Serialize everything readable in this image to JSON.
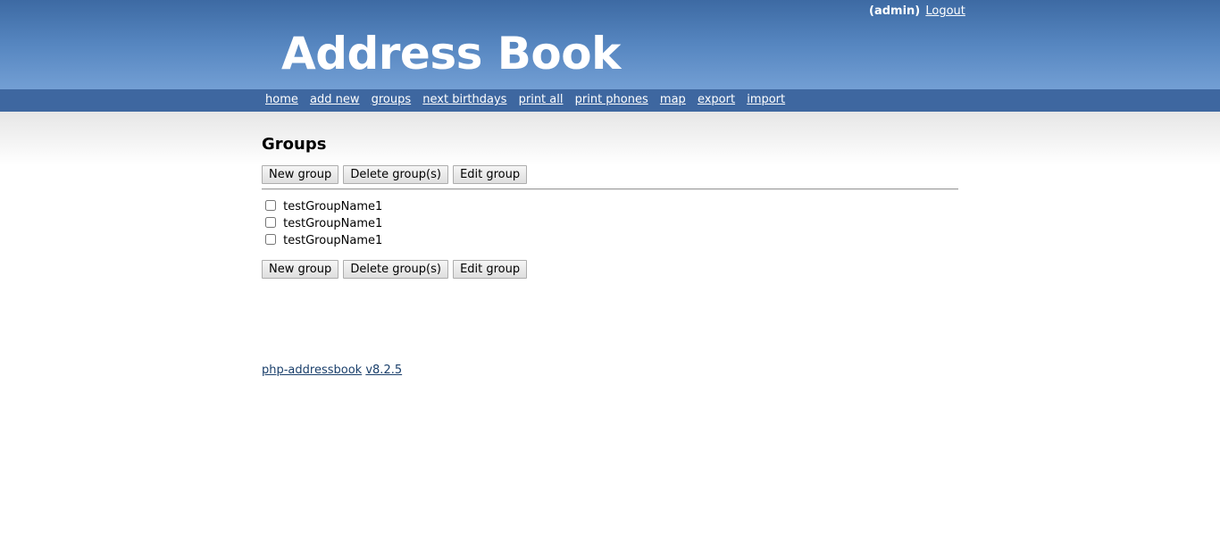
{
  "header": {
    "username": "(admin)",
    "logout_label": "Logout",
    "logo_text": "Address Book"
  },
  "nav": {
    "items": [
      {
        "label": "home"
      },
      {
        "label": "add new"
      },
      {
        "label": "groups"
      },
      {
        "label": "next birthdays"
      },
      {
        "label": "print all"
      },
      {
        "label": "print phones"
      },
      {
        "label": "map"
      },
      {
        "label": "export"
      },
      {
        "label": "import"
      }
    ]
  },
  "main": {
    "title": "Groups",
    "buttons": {
      "new_group": "New group",
      "delete_groups": "Delete group(s)",
      "edit_group": "Edit group"
    },
    "groups": [
      {
        "name": "testGroupName1",
        "checked": false
      },
      {
        "name": "testGroupName1",
        "checked": false
      },
      {
        "name": "testGroupName1",
        "checked": false
      }
    ]
  },
  "footer": {
    "project_link": "php-addressbook",
    "version_link": "v8.2.5"
  },
  "colors": {
    "header_top": "#3d6aa3",
    "header_bottom": "#739fd4",
    "nav_bar": "#3e67a0",
    "footer_link": "#1a3f6b"
  }
}
